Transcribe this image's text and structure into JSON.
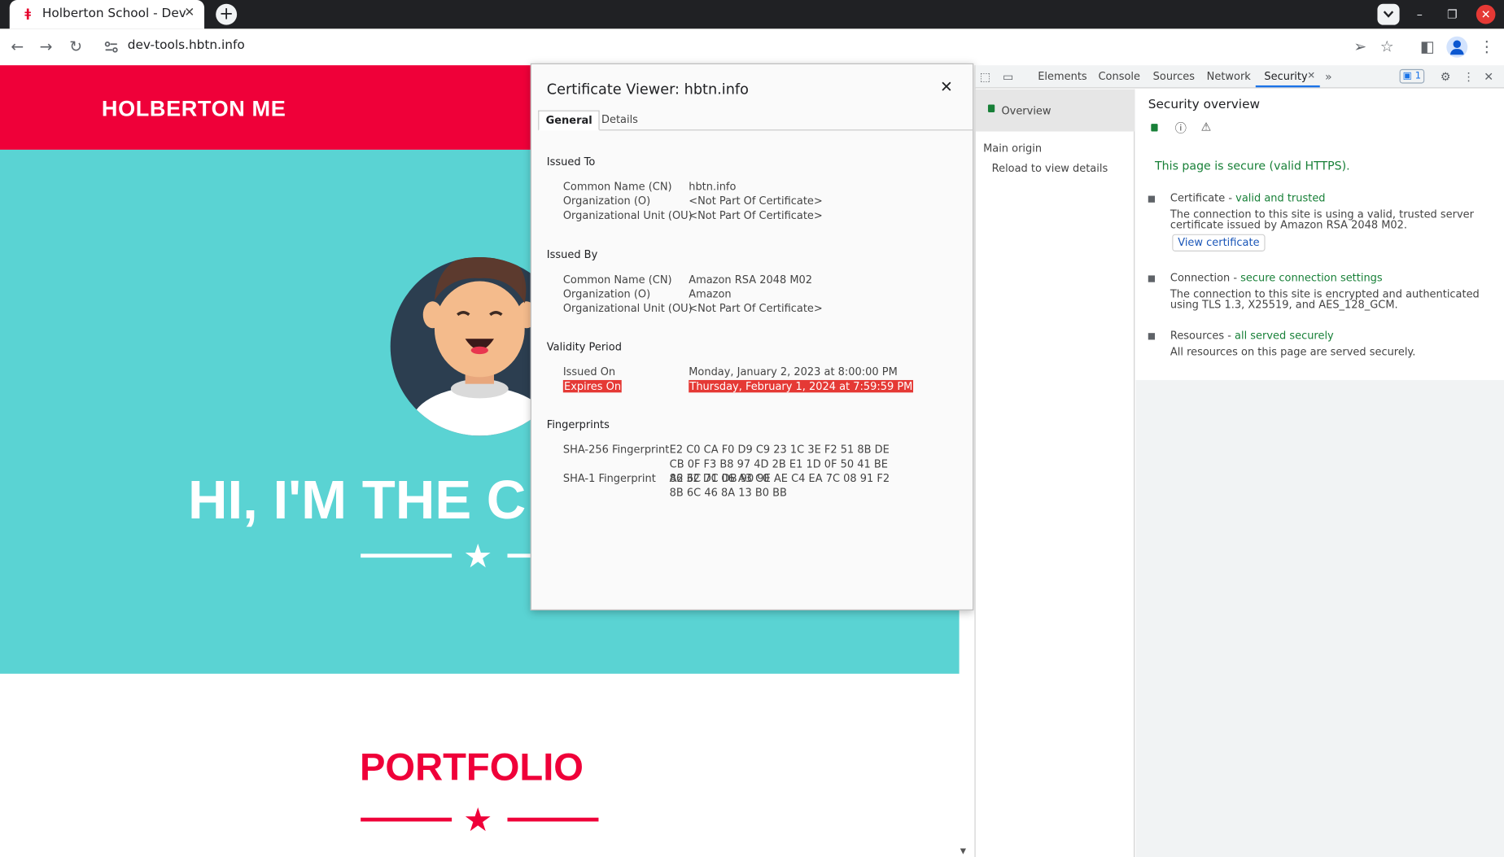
{
  "browser": {
    "tab_title": "Holberton School - Devel",
    "url": "dev-tools.hbtn.info"
  },
  "page": {
    "brand": "HOLBERTON ME",
    "hero_title": "HI, I'M THE C",
    "portfolio_title": "PORTFOLIO",
    "colors": {
      "accent": "#ef0039",
      "hero_bg": "#5ad3d3",
      "white": "#ffffff"
    }
  },
  "cert": {
    "title": "Certificate Viewer: hbtn.info",
    "tabs": [
      "General",
      "Details"
    ],
    "issued_to": {
      "heading": "Issued To",
      "rows": [
        {
          "k": "Common Name (CN)",
          "v": "hbtn.info"
        },
        {
          "k": "Organization (O)",
          "v": "<Not Part Of Certificate>"
        },
        {
          "k": "Organizational Unit (OU)",
          "v": "<Not Part Of Certificate>"
        }
      ]
    },
    "issued_by": {
      "heading": "Issued By",
      "rows": [
        {
          "k": "Common Name (CN)",
          "v": "Amazon RSA 2048 M02"
        },
        {
          "k": "Organization (O)",
          "v": "Amazon"
        },
        {
          "k": "Organizational Unit (OU)",
          "v": "<Not Part Of Certificate>"
        }
      ]
    },
    "validity": {
      "heading": "Validity Period",
      "issued_on_label": "Issued On",
      "issued_on": "Monday, January 2, 2023 at 8:00:00 PM",
      "expires_on_label": "Expires On",
      "expires_on": "Thursday, February 1, 2024 at 7:59:59 PM"
    },
    "fingerprints": {
      "heading": "Fingerprints",
      "sha256_label": "SHA-256 Fingerprint",
      "sha256": "E2 C0 CA F0 D9 C9 23 1C 3E F2 51 8B DE CB 0F F3 B8 97 4D 2B E1 1D 0F 50 41 BE 86 32 D1 06 A3 C0",
      "sha1_label": "SHA-1 Fingerprint",
      "sha1": "A2 6C 7C DB 90 9E AE C4 EA 7C 08 91 F2 8B 6C 46 8A 13 B0 BB"
    }
  },
  "devtools": {
    "tabs": [
      "Elements",
      "Console",
      "Sources",
      "Network",
      "Security"
    ],
    "badge": "1",
    "sidebar": {
      "overview": "Overview",
      "main_origin": "Main origin",
      "reload": "Reload to view details"
    },
    "panel": {
      "heading": "Security overview",
      "secure_msg": "This page is secure (valid HTTPS).",
      "certificate": {
        "label": "Certificate - ",
        "status": "valid and trusted",
        "desc": "The connection to this site is using a valid, trusted server certificate issued by Amazon RSA 2048 M02.",
        "button": "View certificate"
      },
      "connection": {
        "label": "Connection - ",
        "status": "secure connection settings",
        "desc": "The connection to this site is encrypted and authenticated using TLS 1.3, X25519, and AES_128_GCM."
      },
      "resources": {
        "label": "Resources - ",
        "status": "all served securely",
        "desc": "All resources on this page are served securely."
      }
    }
  }
}
